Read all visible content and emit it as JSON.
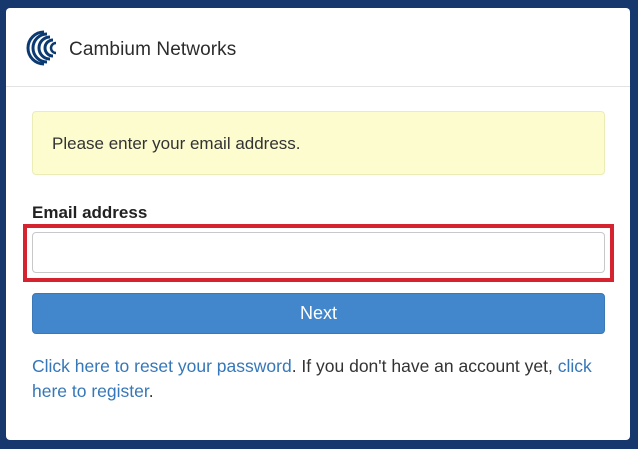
{
  "header": {
    "brand_name": "Cambium Networks",
    "logo_icon": "cambium-logo-icon"
  },
  "alert": {
    "message": "Please enter your email address."
  },
  "form": {
    "email_label": "Email address",
    "email_value": "",
    "email_placeholder": "",
    "next_label": "Next"
  },
  "footer": {
    "reset_link": "Click here to reset your password",
    "middle_text": ". If you don't have an account yet, ",
    "register_link": "click here to register",
    "end_text": "."
  },
  "colors": {
    "page_background": "#16386d",
    "primary_button": "#4286cc",
    "link": "#3577b8",
    "alert_background": "#fcfccf",
    "highlight_border": "#d5232f"
  }
}
